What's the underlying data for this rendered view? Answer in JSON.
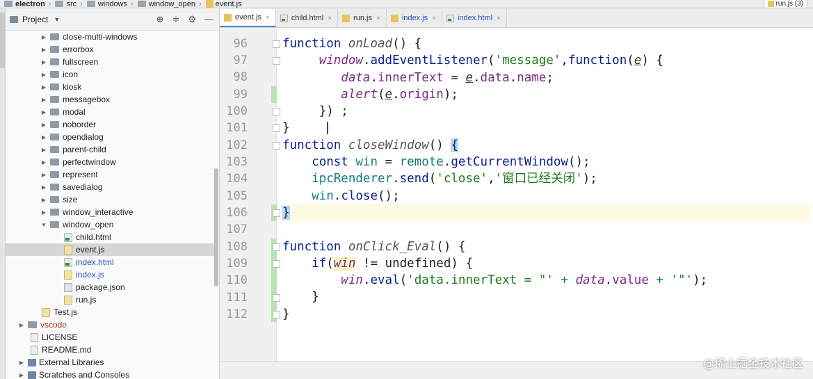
{
  "breadcrumbs": [
    "electron",
    "src",
    "windows",
    "window_open",
    "event.js"
  ],
  "run_config": "run.js (3)",
  "project": {
    "title": "Project",
    "tree": [
      {
        "label": "close-multi-windows",
        "type": "folder",
        "expanded": false
      },
      {
        "label": "errorbox",
        "type": "folder",
        "expanded": false
      },
      {
        "label": "fullscreen",
        "type": "folder",
        "expanded": false
      },
      {
        "label": "icon",
        "type": "folder",
        "expanded": false
      },
      {
        "label": "kiosk",
        "type": "folder",
        "expanded": false
      },
      {
        "label": "messagebox",
        "type": "folder",
        "expanded": false
      },
      {
        "label": "modal",
        "type": "folder",
        "expanded": false
      },
      {
        "label": "noborder",
        "type": "folder",
        "expanded": false
      },
      {
        "label": "opendialog",
        "type": "folder",
        "expanded": false
      },
      {
        "label": "parent-child",
        "type": "folder",
        "expanded": false
      },
      {
        "label": "perfectwindow",
        "type": "folder",
        "expanded": false
      },
      {
        "label": "represent",
        "type": "folder",
        "expanded": false
      },
      {
        "label": "savedialog",
        "type": "folder",
        "expanded": false
      },
      {
        "label": "size",
        "type": "folder",
        "expanded": false
      },
      {
        "label": "window_interactive",
        "type": "folder",
        "expanded": false
      },
      {
        "label": "window_open",
        "type": "folder",
        "expanded": true
      },
      {
        "label": "child.html",
        "type": "html"
      },
      {
        "label": "event.js",
        "type": "js",
        "selected": true
      },
      {
        "label": "index.html",
        "type": "html",
        "modified": true
      },
      {
        "label": "index.js",
        "type": "js",
        "modified": true
      },
      {
        "label": "package.json",
        "type": "json"
      },
      {
        "label": "run.js",
        "type": "js"
      },
      {
        "label": "Test.js",
        "type": "js"
      },
      {
        "label": "vscode",
        "type": "folder",
        "expanded": false,
        "excluded": true
      },
      {
        "label": "LICENSE",
        "type": "text"
      },
      {
        "label": "README.md",
        "type": "text"
      },
      {
        "label": "External Libraries",
        "type": "lib"
      },
      {
        "label": "Scratches and Consoles",
        "type": "lib"
      }
    ]
  },
  "tabs": [
    {
      "label": "event.js",
      "type": "js",
      "active": true
    },
    {
      "label": "child.html",
      "type": "html"
    },
    {
      "label": "run.js",
      "type": "js"
    },
    {
      "label": "index.js",
      "type": "js",
      "modified": true
    },
    {
      "label": "index.html",
      "type": "html",
      "modified": true
    }
  ],
  "editor": {
    "line_numbers": [
      "96",
      "97",
      "98",
      "99",
      "100",
      "101",
      "102",
      "103",
      "104",
      "105",
      "106",
      "107",
      "108",
      "109",
      "110",
      "111",
      "112"
    ],
    "current_line": "106"
  },
  "code": {
    "l96_kw": "function",
    "l96_name": "onLoad",
    "l96_tail": "() {",
    "l97_obj": "window",
    "l97_meth": "addEventListener",
    "l97_str": "'message'",
    "l97_kw": "function",
    "l97_param": "e",
    "l97_tail": ") {",
    "l98_var": "data",
    "l98_prop": "innerText",
    "l98_eq": " = ",
    "l98_e": "e",
    "l98_prop2": "data",
    "l98_prop3": "name",
    "l99_fn": "alert",
    "l99_e": "e",
    "l99_prop": "origin",
    "l100": "}) ;",
    "l101": "}",
    "l102_kw": "function",
    "l102_name": "closeWindow",
    "l102_paren": "() ",
    "l102_brace": "{",
    "l103_kw": "const",
    "l103_var": "win",
    "l103_obj": "remote",
    "l103_meth": "getCurrentWindow",
    "l103_tail": "();",
    "l104_obj": "ipcRenderer",
    "l104_meth": "send",
    "l104_s1": "'close'",
    "l104_s2": "'窗口已经关闭'",
    "l104_tail": ");",
    "l105_var": "win",
    "l105_meth": "close",
    "l105_tail": "();",
    "l106": "}",
    "l108_kw": "function",
    "l108_name": "onClick_Eval",
    "l108_tail": "() {",
    "l109_kw": "if",
    "l109_var": "win",
    "l109_op": " != ",
    "l109_undef": "undefined",
    "l109_tail": ") {",
    "l110_var": "win",
    "l110_meth": "eval",
    "l110_s1": "'data.innerText = \"' + ",
    "l110_obj": "data",
    "l110_prop": "value",
    "l110_s2": " + '\"'",
    "l110_tail": ");",
    "l111": "}",
    "l112": "}"
  },
  "watermark": "@稀土掘金技术社区"
}
